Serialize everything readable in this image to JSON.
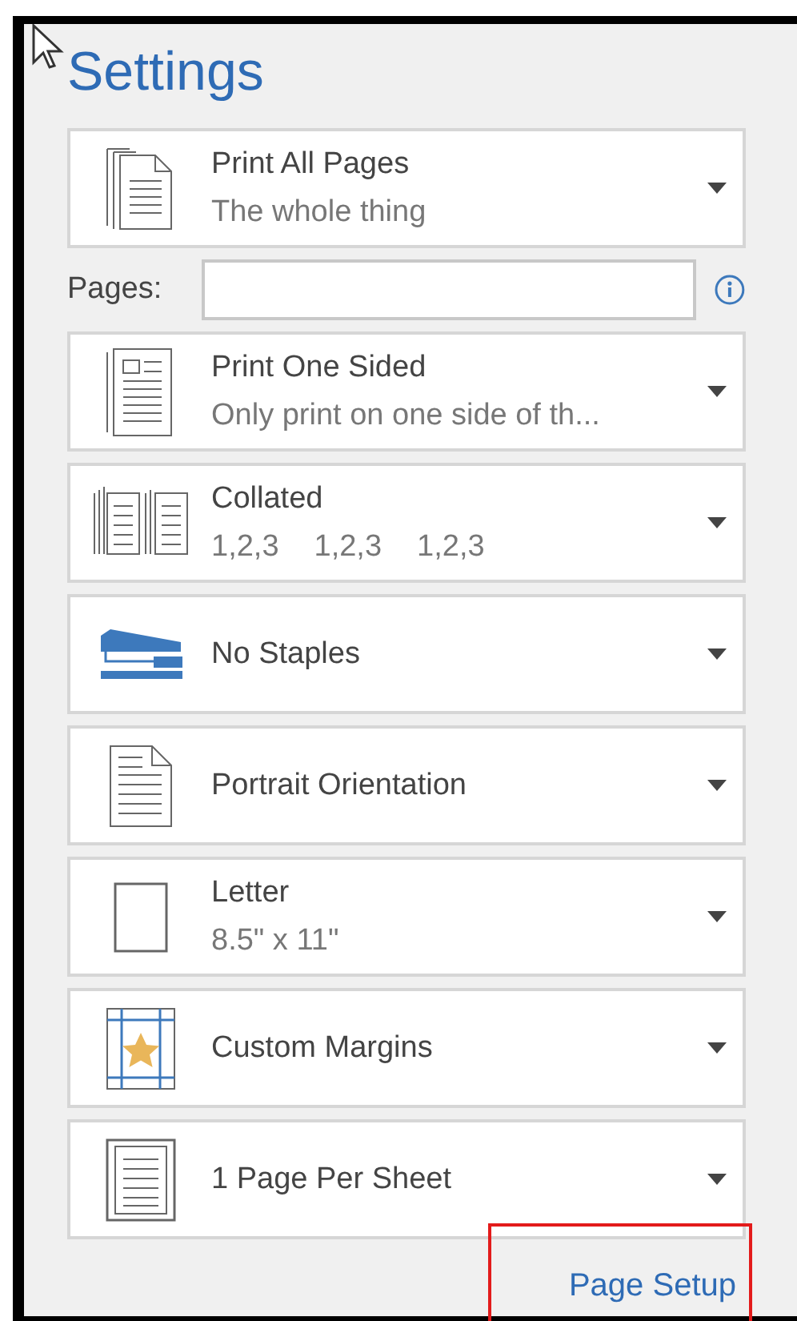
{
  "heading": "Settings",
  "options": [
    {
      "kind": "pages",
      "title": "Print All Pages",
      "subtitle": "The whole thing"
    },
    {
      "kind": "sides",
      "title": "Print One Sided",
      "subtitle": "Only print on one side of th..."
    },
    {
      "kind": "collate",
      "title": "Collated",
      "subtitle_groups": [
        "1,2,3",
        "1,2,3",
        "1,2,3"
      ]
    },
    {
      "kind": "staples",
      "title": "No Staples"
    },
    {
      "kind": "orientation",
      "title": "Portrait Orientation"
    },
    {
      "kind": "paper",
      "title": "Letter",
      "subtitle": "8.5\" x 11\""
    },
    {
      "kind": "margins",
      "title": "Custom Margins"
    },
    {
      "kind": "per-sheet",
      "title": "1 Page Per Sheet"
    }
  ],
  "pages_field": {
    "label": "Pages:"
  },
  "link": "Page Setup"
}
